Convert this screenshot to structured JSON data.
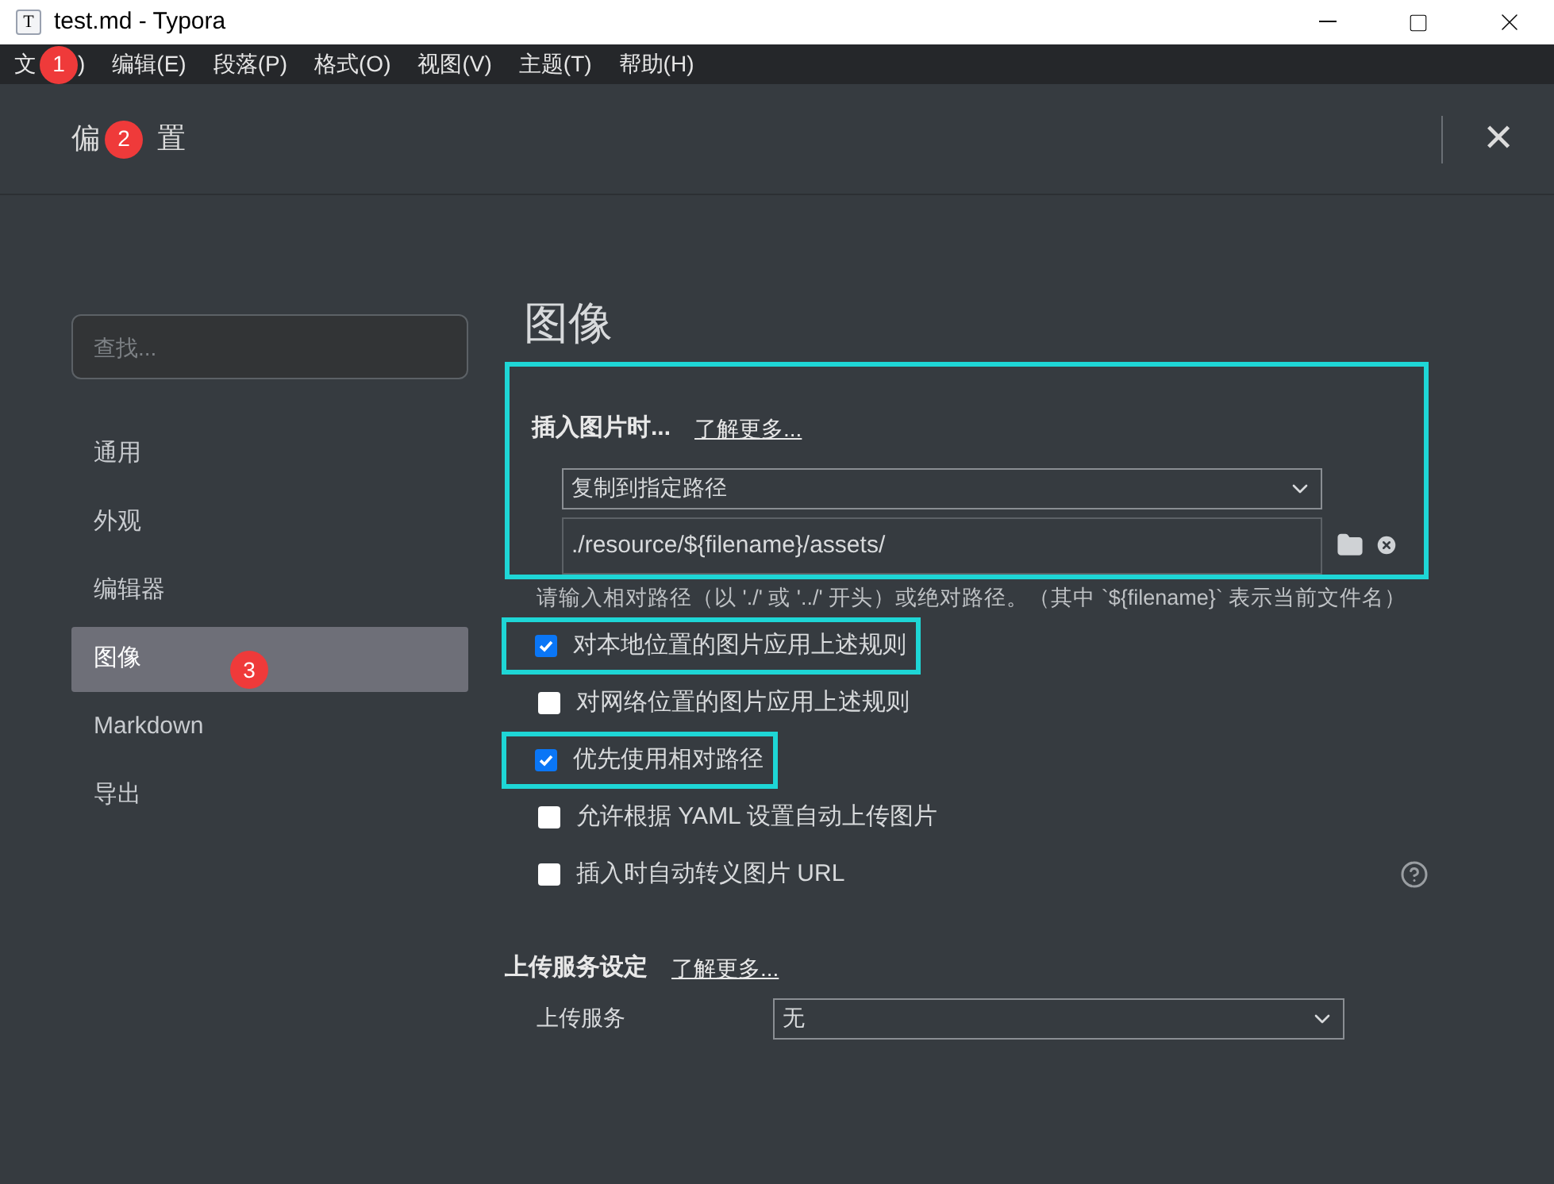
{
  "window": {
    "title": "test.md - Typora",
    "app_icon": "T"
  },
  "menu": [
    {
      "label": "文",
      "label_end": ")",
      "badge": "1"
    },
    {
      "label": "编辑(E)"
    },
    {
      "label": "段落(P)"
    },
    {
      "label": "格式(O)"
    },
    {
      "label": "视图(V)"
    },
    {
      "label": "主题(T)"
    },
    {
      "label": "帮助(H)"
    }
  ],
  "dialog": {
    "title": "偏",
    "title_end": "置",
    "title_badge": "2",
    "close": "✕"
  },
  "sidebar": {
    "search": {
      "placeholder": "查找..."
    },
    "items": [
      {
        "label": "通用",
        "selected": false
      },
      {
        "label": "外观",
        "selected": false
      },
      {
        "label": "编辑器",
        "selected": false
      },
      {
        "label": "图像",
        "selected": true,
        "badge": "3"
      },
      {
        "label": "Markdown",
        "selected": false
      },
      {
        "label": "导出",
        "selected": false
      }
    ]
  },
  "content": {
    "heading": "图像",
    "insert": {
      "title": "插入图片时...",
      "link": "了解更多...",
      "highlighted": true,
      "select": "复制到指定路径",
      "path": "./resource/${filename}/assets/"
    },
    "hint": "请输入相对路径（以 './' 或 '../' 开头）或绝对路径。（其中 `${filename}` 表示当前文件名）",
    "options": [
      {
        "label": "对本地位置的图片应用上述规则",
        "checked": true,
        "highlighted": true
      },
      {
        "label": "对网络位置的图片应用上述规则",
        "checked": false,
        "highlighted": false
      },
      {
        "label": "优先使用相对路径",
        "checked": true,
        "highlighted": true
      },
      {
        "label": "允许根据 YAML 设置自动上传图片",
        "checked": false,
        "highlighted": false
      },
      {
        "label": "插入时自动转义图片 URL",
        "checked": false,
        "highlighted": false,
        "help": true
      }
    ],
    "upload": {
      "title": "上传服务设定",
      "link": "了解更多...",
      "field_label": "上传服务",
      "select": "无"
    }
  }
}
